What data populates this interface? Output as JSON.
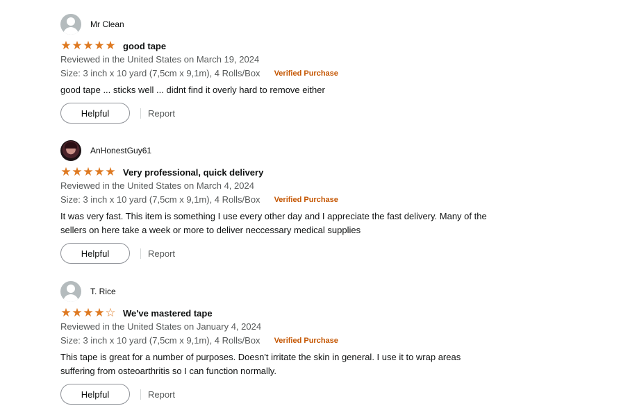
{
  "reviews": [
    {
      "profile_name": "Mr Clean",
      "avatar": "default-avatar-icon",
      "rating": 5,
      "stars": [
        "★",
        "★",
        "★",
        "★",
        "★"
      ],
      "title": "good tape",
      "date_line": "Reviewed in the United States on March 19, 2024",
      "size_line": "Size: 3 inch x 10 yard (7,5cm x 9,1m), 4 Rolls/Box",
      "verified": "Verified Purchase",
      "body_lines": [
        "good tape ... sticks well ... didnt find it overly hard to remove either"
      ],
      "helpful_label": "Helpful",
      "report_label": "Report"
    },
    {
      "profile_name": "AnHonestGuy61",
      "avatar": "profile-photo",
      "rating": 5,
      "stars": [
        "★",
        "★",
        "★",
        "★",
        "★"
      ],
      "title": "Very professional, quick delivery",
      "date_line": "Reviewed in the United States on March 4, 2024",
      "size_line": "Size: 3 inch x 10 yard (7,5cm x 9,1m), 4 Rolls/Box",
      "verified": "Verified Purchase",
      "body_lines": [
        "It was very fast. This item is something I use every other day and I appreciate the fast delivery. Many of the",
        "sellers on here take a week or more to deliver neccessary medical supplies"
      ],
      "helpful_label": "Helpful",
      "report_label": "Report"
    },
    {
      "profile_name": "T. Rice",
      "avatar": "default-avatar-icon",
      "rating": 4,
      "stars": [
        "★",
        "★",
        "★",
        "★",
        "☆"
      ],
      "title": "We've mastered tape",
      "date_line": "Reviewed in the United States on January 4, 2024",
      "size_line": "Size: 3 inch x 10 yard (7,5cm x 9,1m), 4 Rolls/Box",
      "verified": "Verified Purchase",
      "body_lines": [
        "This tape is great for a number of purposes. Doesn't irritate the skin in general. I use it to wrap areas",
        "suffering from osteoarthritis so I can function normally."
      ],
      "helpful_label": "Helpful",
      "report_label": "Report"
    }
  ],
  "colors": {
    "star": "#de7921",
    "verified": "#c45500",
    "meta_text": "#565959",
    "button_border": "#8d9096"
  }
}
